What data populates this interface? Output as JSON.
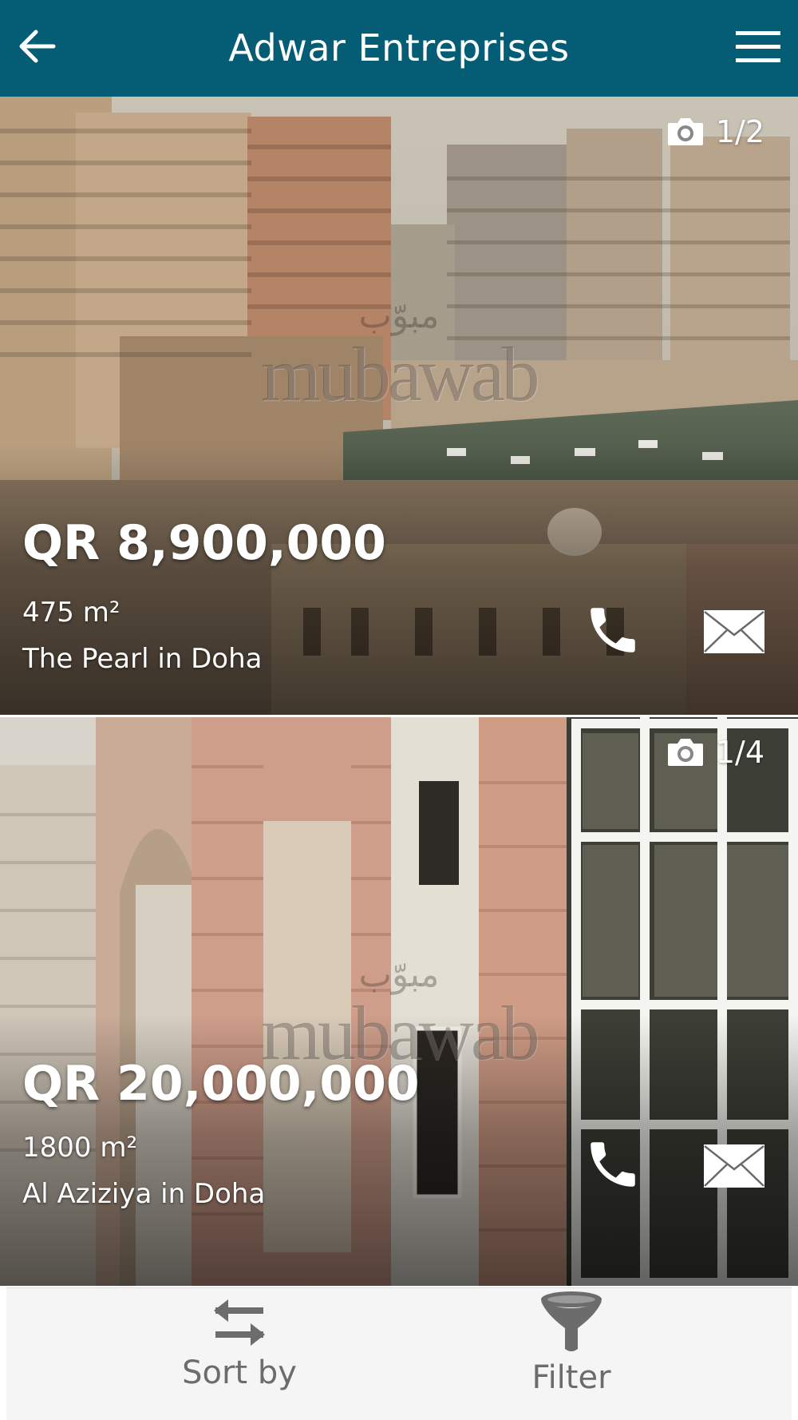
{
  "header": {
    "title": "Adwar Entreprises",
    "back_icon": "arrow-left-icon",
    "menu_icon": "hamburger-menu-icon",
    "background": "#055d75"
  },
  "listings": [
    {
      "photo_counter": "1/2",
      "price": "QR 8,900,000",
      "area": "475 m²",
      "location": "The Pearl in Doha",
      "watermark": {
        "arabic": "مبوّب",
        "latin": "mubawab"
      },
      "icons": [
        "camera-icon",
        "phone-icon",
        "envelope-icon"
      ]
    },
    {
      "photo_counter": "1/4",
      "price": "QR 20,000,000",
      "area": "1800 m²",
      "location": "Al Aziziya in Doha",
      "watermark": {
        "arabic": "مبوّب",
        "latin": "mubawab"
      },
      "icons": [
        "camera-icon",
        "phone-icon",
        "envelope-icon"
      ]
    }
  ],
  "bottom_bar": {
    "sort_label": "Sort by",
    "filter_label": "Filter",
    "sort_icon": "swap-arrows-icon",
    "filter_icon": "funnel-icon"
  }
}
